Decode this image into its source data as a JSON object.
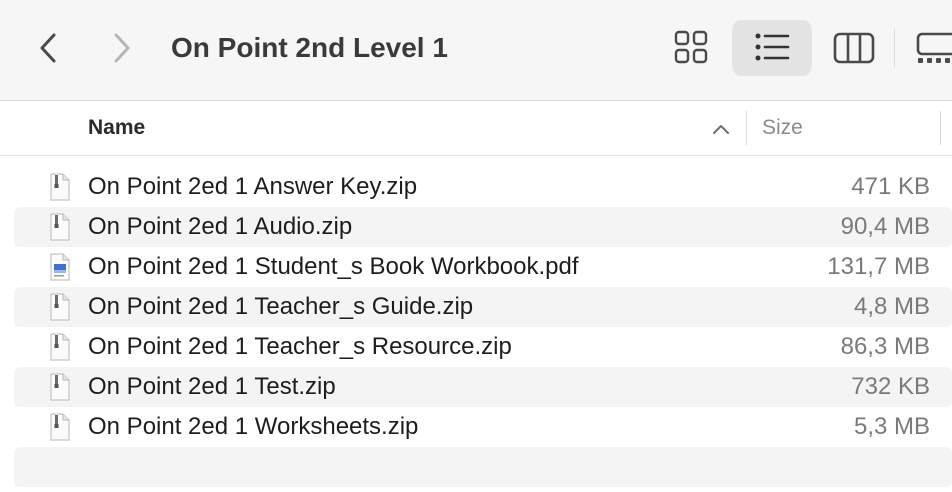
{
  "window": {
    "title": "On Point 2nd Level 1"
  },
  "toolbar": {
    "back_icon": "chevron-left-icon",
    "forward_icon": "chevron-right-icon",
    "view_modes": [
      "icon-view",
      "list-view",
      "column-view",
      "gallery-view"
    ],
    "selected_view": "list-view"
  },
  "columns": {
    "name": "Name",
    "size": "Size",
    "sort": "ascending"
  },
  "files": [
    {
      "name": "On Point 2ed 1 Answer Key.zip",
      "size": "471 KB",
      "icon": "zip-file-icon"
    },
    {
      "name": "On Point 2ed 1 Audio.zip",
      "size": "90,4 MB",
      "icon": "zip-file-icon"
    },
    {
      "name": "On Point 2ed 1 Student_s Book Workbook.pdf",
      "size": "131,7 MB",
      "icon": "pdf-file-icon"
    },
    {
      "name": "On Point 2ed 1 Teacher_s Guide.zip",
      "size": "4,8 MB",
      "icon": "zip-file-icon"
    },
    {
      "name": "On Point 2ed 1 Teacher_s Resource.zip",
      "size": "86,3 MB",
      "icon": "zip-file-icon"
    },
    {
      "name": "On Point 2ed 1 Test.zip",
      "size": "732 KB",
      "icon": "zip-file-icon"
    },
    {
      "name": "On Point 2ed 1 Worksheets.zip",
      "size": "5,3 MB",
      "icon": "zip-file-icon"
    }
  ],
  "colors": {
    "toolbar_bg": "#f6f6f6",
    "stripe": "#f4f4f5",
    "selected_view_bg": "#e3e3e3"
  }
}
